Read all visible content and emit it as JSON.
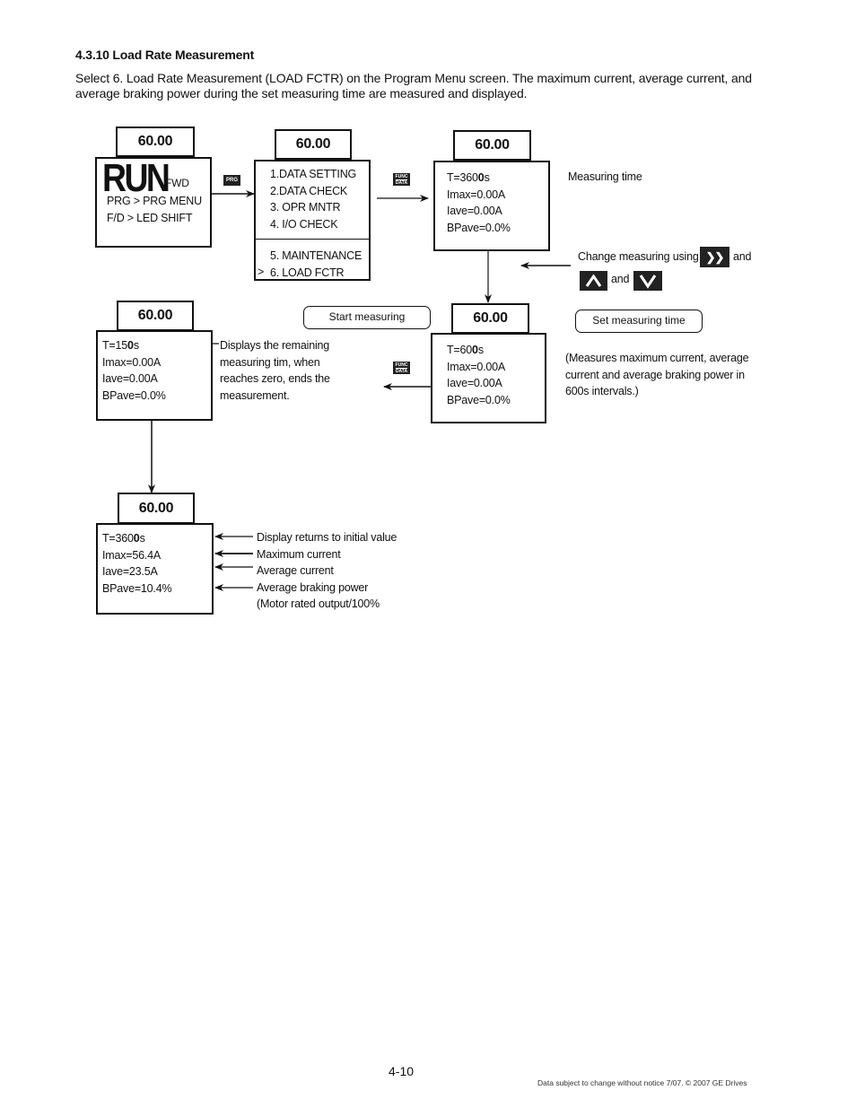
{
  "section": {
    "heading": "4.3.10 Load Rate Measurement",
    "intro": "Select 6. Load Rate Measurement (LOAD FCTR) on the Program Menu screen. The maximum current, average current, and average braking power during the set measuring time are measured and displayed."
  },
  "screens": {
    "run": {
      "freq": "60.00",
      "run_label": "RUN",
      "direction": "FWD",
      "lines": [
        "PRG > PRG MENU",
        "F/D > LED SHIFT"
      ]
    },
    "menu": {
      "freq": "60.00",
      "items_top": [
        "1.DATA SETTING",
        "2.DATA CHECK",
        "3. OPR MNTR",
        "4. I/O CHECK"
      ],
      "items_bottom": [
        "5. MAINTENANCE",
        "6. LOAD FCTR"
      ],
      "cursor": ">"
    },
    "initial": {
      "freq": "60.00",
      "t_prefix": "T=360",
      "t_bold": "0",
      "t_suffix": "s",
      "imax": "Imax=0.00A",
      "iave": "Iave=0.00A",
      "bpave": "BPave=0.0%"
    },
    "set_time": {
      "freq": "60.00",
      "t_prefix": "T=60",
      "t_bold": "0",
      "t_suffix": "s",
      "imax": "Imax=0.00A",
      "iave": "Iave=0.00A",
      "bpave": "BPave=0.0%"
    },
    "measuring": {
      "freq": "60.00",
      "t_prefix": "T=15",
      "t_bold": "0",
      "t_suffix": "s",
      "imax": "Imax=0.00A",
      "iave": "Iave=0.00A",
      "bpave": "BPave=0.0%"
    },
    "result": {
      "freq": "60.00",
      "t_prefix": "T=360",
      "t_bold": "0",
      "t_suffix": "s",
      "imax": "Imax=56.4A",
      "iave": "Iave=23.5A",
      "bpave": "BPave=10.4%"
    }
  },
  "keys": {
    "prg": "PRG",
    "func_top": "FUNC",
    "func_bottom": "DATA",
    "shift": "❯❯",
    "up": "⋀",
    "down": "⋁"
  },
  "annotations": {
    "measuring_time": "Measuring time",
    "change_prefix": "Change measuring using",
    "and1": "and",
    "and2": "and",
    "set_measuring_time": "Set measuring time",
    "start_measuring": "Start measuring",
    "interval_note": [
      "(Measures maximum current, average",
      "current and average braking power in",
      "600s intervals.)"
    ],
    "remaining_note": [
      "Displays the remaining",
      "measuring tim, when",
      "reaches zero, ends the",
      "measurement."
    ],
    "result_labels": [
      "Display returns to initial value",
      "Maximum current",
      "Average current",
      "Average braking power",
      "(Motor rated output/100%"
    ]
  },
  "footer": {
    "page_number": "4-10",
    "notice": "Data subject to change without notice 7/07. © 2007 GE Drives"
  }
}
